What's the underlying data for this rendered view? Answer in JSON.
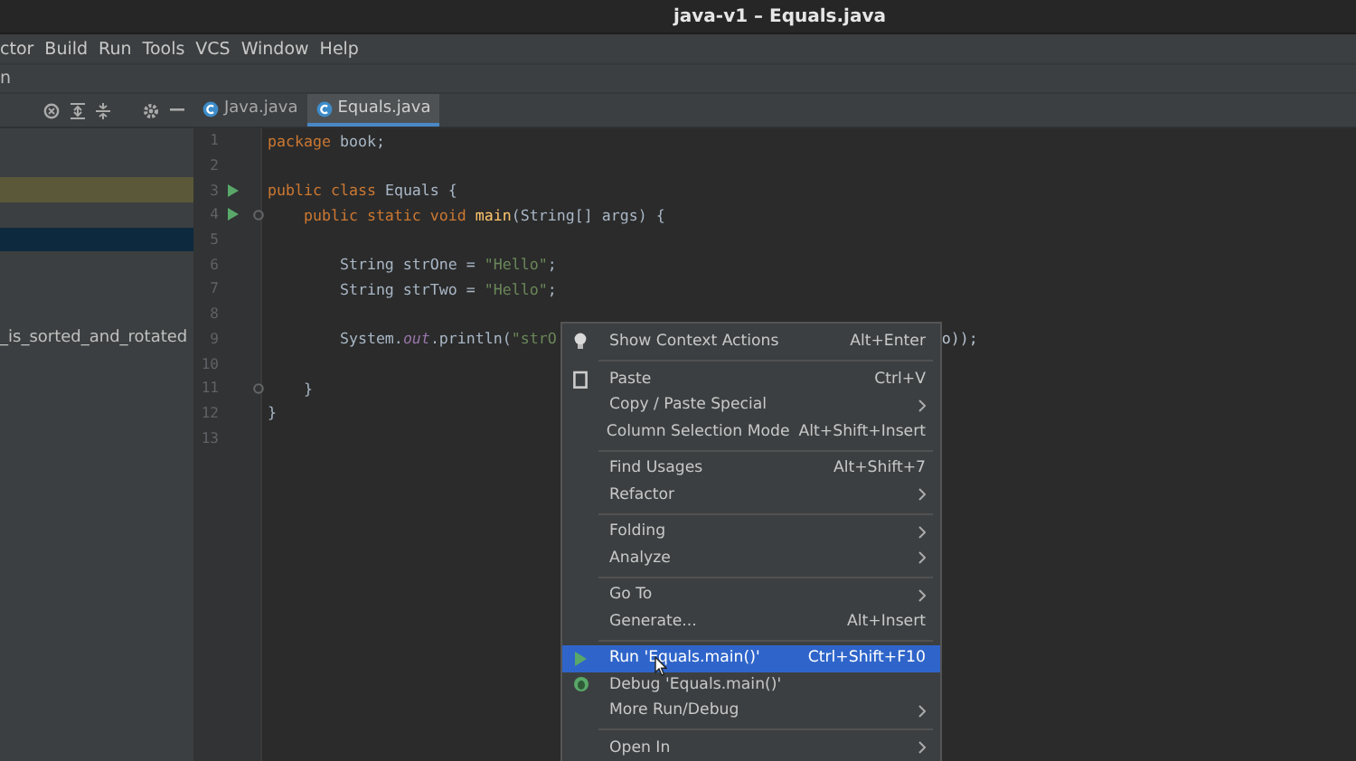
{
  "window": {
    "title": "java-v1 – Equals.java"
  },
  "menu_bar": [
    "ctor",
    "Build",
    "Run",
    "Tools",
    "VCS",
    "Window",
    "Help"
  ],
  "nav_bar": {
    "text": "n"
  },
  "tabs": [
    {
      "label": "Java.java",
      "selected": false
    },
    {
      "label": "Equals.java",
      "selected": true
    }
  ],
  "sidebar": {
    "rows": [
      {
        "selected": false,
        "highlighted": false
      },
      {
        "selected": false,
        "highlighted": false
      },
      {
        "selected": false,
        "highlighted": true
      },
      {
        "selected": false,
        "highlighted": false
      },
      {
        "selected": true,
        "highlighted": false
      },
      {
        "selected": false,
        "highlighted": false
      },
      {
        "selected": false,
        "highlighted": false
      },
      {
        "selected": false,
        "highlighted": false
      },
      {
        "selected": false,
        "highlighted": false,
        "text": "_is_sorted_and_rotated"
      }
    ]
  },
  "editor": {
    "lines": [
      {
        "number": "1",
        "tokens": [
          {
            "kind": "keyword",
            "text": "package"
          },
          {
            "kind": "plain",
            "text": " book;"
          }
        ]
      },
      {
        "number": "2"
      },
      {
        "number": "3",
        "runnable": true,
        "tokens": [
          {
            "kind": "keyword",
            "text": "public class"
          },
          {
            "kind": "plain",
            "text": " Equals {"
          }
        ]
      },
      {
        "number": "4",
        "runnable": true,
        "fold": true,
        "tokens": [
          {
            "kind": "keyword",
            "text": "    public static void"
          },
          {
            "kind": "method",
            "text": " main"
          },
          {
            "kind": "plain",
            "text": "(String[] args) {"
          }
        ]
      },
      {
        "number": "5"
      },
      {
        "number": "6",
        "tokens": [
          {
            "kind": "plain",
            "text": "        String strOne = "
          },
          {
            "kind": "string",
            "text": "\"Hello\""
          },
          {
            "kind": "plain",
            "text": ";"
          }
        ]
      },
      {
        "number": "7",
        "tokens": [
          {
            "kind": "plain",
            "text": "        String strTwo = "
          },
          {
            "kind": "string",
            "text": "\"Hello\""
          },
          {
            "kind": "plain",
            "text": ";"
          }
        ]
      },
      {
        "number": "8"
      },
      {
        "number": "9",
        "tokens": [
          {
            "kind": "plain",
            "text": "        System."
          },
          {
            "kind": "field",
            "text": "out"
          },
          {
            "kind": "plain",
            "text": ".println("
          },
          {
            "kind": "string",
            "text": "\"strO"
          }
        ],
        "tail": "o));"
      },
      {
        "number": "10"
      },
      {
        "number": "11",
        "fold": true,
        "tokens": [
          {
            "kind": "plain",
            "text": "    }"
          }
        ]
      },
      {
        "number": "12",
        "tokens": [
          {
            "kind": "plain",
            "text": "}"
          }
        ]
      },
      {
        "number": "13"
      }
    ]
  },
  "context_menu": {
    "items": [
      {
        "kind": "item",
        "label": "Show Context Actions",
        "shortcut": "Alt+Enter",
        "selected": false
      },
      {
        "kind": "separator"
      },
      {
        "kind": "item",
        "label": "Paste",
        "shortcut": "Ctrl+V",
        "selected": false
      },
      {
        "kind": "item",
        "label": "Copy / Paste Special",
        "submenu": true,
        "selected": false
      },
      {
        "kind": "item",
        "label": "Column Selection Mode",
        "shortcut": "Alt+Shift+Insert",
        "selected": false
      },
      {
        "kind": "separator"
      },
      {
        "kind": "item",
        "label": "Find Usages",
        "shortcut": "Alt+Shift+7",
        "selected": false
      },
      {
        "kind": "item",
        "label": "Refactor",
        "submenu": true,
        "selected": false
      },
      {
        "kind": "separator"
      },
      {
        "kind": "item",
        "label": "Folding",
        "submenu": true,
        "selected": false
      },
      {
        "kind": "item",
        "label": "Analyze",
        "submenu": true,
        "selected": false
      },
      {
        "kind": "separator"
      },
      {
        "kind": "item",
        "label": "Go To",
        "submenu": true,
        "selected": false
      },
      {
        "kind": "item",
        "label": "Generate...",
        "shortcut": "Alt+Insert",
        "selected": false
      },
      {
        "kind": "separator"
      },
      {
        "kind": "item",
        "label": "Run 'Equals.main()'",
        "shortcut": "Ctrl+Shift+F10",
        "selected": true
      },
      {
        "kind": "item",
        "label": "Debug 'Equals.main()'",
        "selected": false
      },
      {
        "kind": "item",
        "label": "More Run/Debug",
        "submenu": true,
        "selected": false
      },
      {
        "kind": "separator"
      },
      {
        "kind": "item",
        "label": "Open In",
        "submenu": true,
        "selected": false
      }
    ]
  }
}
